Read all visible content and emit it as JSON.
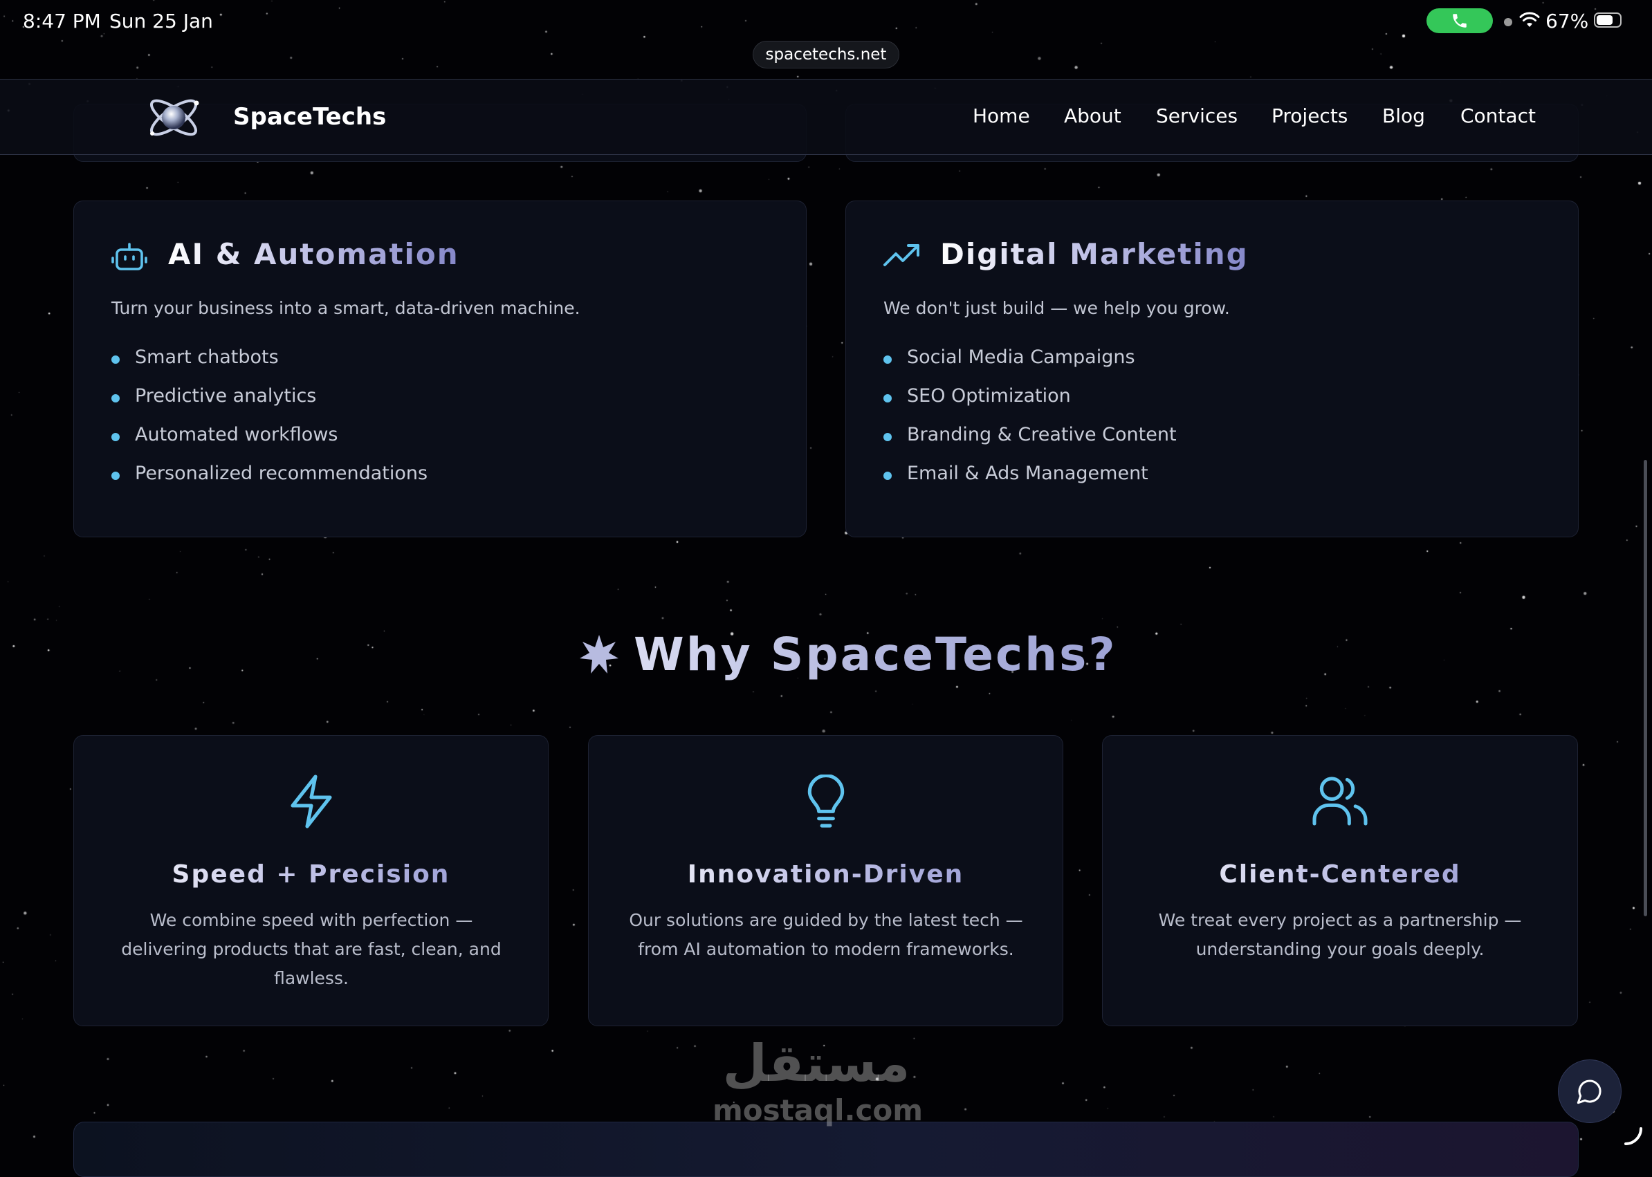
{
  "status_bar": {
    "time": "8:47 PM",
    "date": "Sun 25 Jan",
    "battery": "67%",
    "battery_level": 0.67
  },
  "browser": {
    "url": "spacetechs.net"
  },
  "nav": {
    "brand": "SpaceTechs",
    "links": [
      "Home",
      "About",
      "Services",
      "Projects",
      "Blog",
      "Contact"
    ]
  },
  "services": [
    {
      "title": "AI & Automation",
      "description": "Turn your business into a smart, data-driven machine.",
      "items": [
        "Smart chatbots",
        "Predictive analytics",
        "Automated workflows",
        "Personalized recommendations"
      ],
      "icon": "robot-icon"
    },
    {
      "title": "Digital Marketing",
      "description": "We don't just build — we help you grow.",
      "items": [
        "Social Media Campaigns",
        "SEO Optimization",
        "Branding & Creative Content",
        "Email & Ads Management"
      ],
      "icon": "trending-up-icon"
    }
  ],
  "why": {
    "title": "Why SpaceTechs?",
    "icon": "sparkle-icon",
    "features": [
      {
        "title": "Speed + Precision",
        "description": "We combine speed with perfection — delivering products that are fast, clean, and flawless.",
        "icon": "lightning-icon"
      },
      {
        "title": "Innovation-Driven",
        "description": "Our solutions are guided by the latest tech — from AI automation to modern frameworks.",
        "icon": "lightbulb-icon"
      },
      {
        "title": "Client-Centered",
        "description": "We treat every project as a partnership — understanding your goals deeply.",
        "icon": "users-icon"
      }
    ]
  },
  "watermark": {
    "arabic": "مستقل",
    "latin": "mostaql.com"
  },
  "colors": {
    "background": "#020205",
    "card": "#0b0e19",
    "accent": "#5fc3ee",
    "call_green": "#34c759",
    "heading_purple": "#8587c9"
  }
}
